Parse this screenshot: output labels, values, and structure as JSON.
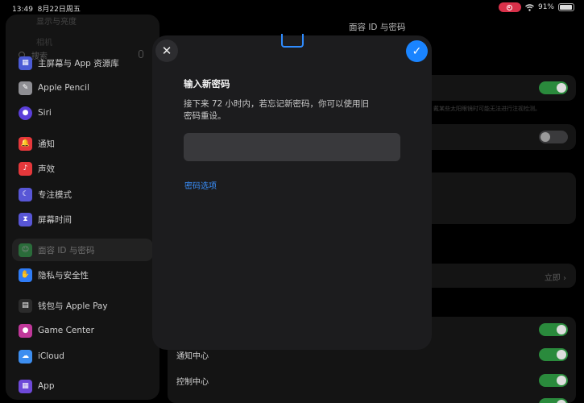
{
  "status_bar": {
    "time": "13:49",
    "date": "8月22日周五",
    "battery": "91%",
    "battery_level": 0.91
  },
  "sidebar": {
    "ghost_items": [
      "显示与亮度",
      "相机"
    ],
    "search_placeholder": "搜索",
    "items": [
      {
        "label": "主屏幕与 App 资源库",
        "icon": "home-screen-icon",
        "color": "#4b5bd6",
        "glyph": "▦"
      },
      {
        "label": "Apple Pencil",
        "icon": "pencil-icon",
        "color": "#8e8e93",
        "glyph": "✎"
      },
      {
        "label": "Siri",
        "icon": "siri-icon",
        "color": "#5b3fd9",
        "glyph": "●"
      },
      {
        "label": "通知",
        "icon": "notifications-icon",
        "color": "#e5383b",
        "glyph": "🔔"
      },
      {
        "label": "声效",
        "icon": "sounds-icon",
        "color": "#e5383b",
        "glyph": "♪"
      },
      {
        "label": "专注模式",
        "icon": "focus-icon",
        "color": "#5856d6",
        "glyph": "☾"
      },
      {
        "label": "屏幕时间",
        "icon": "screen-time-icon",
        "color": "#5856d6",
        "glyph": "⧗"
      },
      {
        "label": "面容 ID 与密码",
        "icon": "face-id-icon",
        "color": "#34c759",
        "glyph": "☺",
        "selected": true
      },
      {
        "label": "隐私与安全性",
        "icon": "privacy-icon",
        "color": "#2f7cf6",
        "glyph": "✋"
      },
      {
        "label": "钱包与 Apple Pay",
        "icon": "wallet-icon",
        "color": "#2b2b2b",
        "glyph": "▤"
      },
      {
        "label": "Game Center",
        "icon": "game-center-icon",
        "color": "#c0389a",
        "glyph": "●"
      },
      {
        "label": "iCloud",
        "icon": "icloud-icon",
        "color": "#3d8ef0",
        "glyph": "☁"
      },
      {
        "label": "App",
        "icon": "app-store-icon",
        "color": "#6e49d8",
        "glyph": "▦"
      }
    ]
  },
  "detail": {
    "title": "面容 ID 与密码",
    "faint_note": "戴某些太阳眼镜时可能无法进行注视检测。",
    "now_label": "立即",
    "rows": [
      {
        "label": "通知中心"
      },
      {
        "label": "控制中心"
      }
    ]
  },
  "modal": {
    "heading": "输入新密码",
    "description": "接下来 72 小时内，若忘记新密码，你可以使用旧密码重设。",
    "input_value": "",
    "link_label": "密码选项",
    "colors": {
      "accent": "#1a84ff",
      "link": "#3a91ff"
    }
  }
}
